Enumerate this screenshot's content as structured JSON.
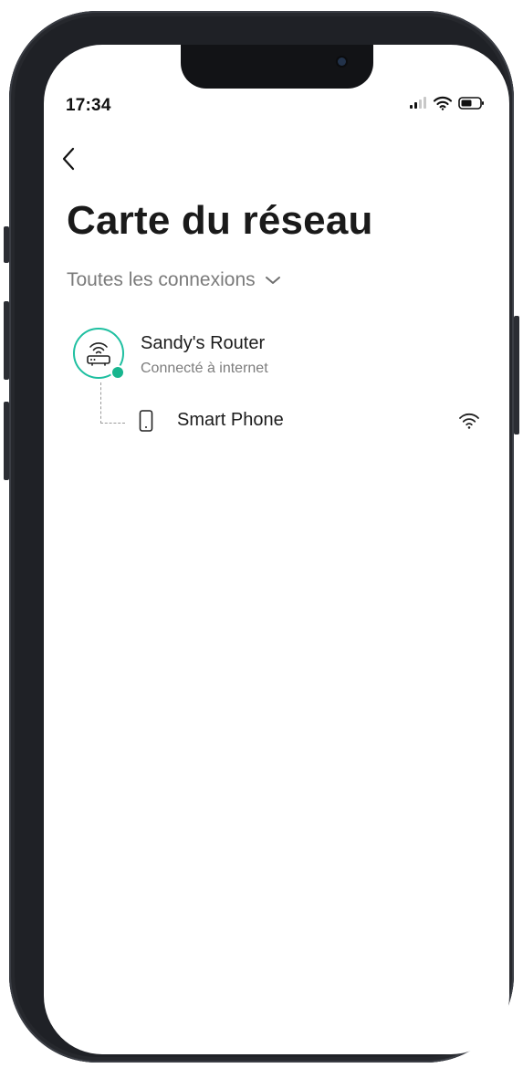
{
  "status_bar": {
    "time": "17:34",
    "signal_icon": "signal-bars-icon",
    "wifi_icon": "wifi-icon",
    "battery_icon": "battery-icon"
  },
  "nav": {
    "back_icon": "chevron-left-icon"
  },
  "page": {
    "title": "Carte du réseau"
  },
  "filter": {
    "label": "Toutes les connexions",
    "icon": "chevron-down-icon"
  },
  "router": {
    "name": "Sandy's Router",
    "status": "Connecté à internet",
    "icon": "router-icon",
    "accent_color": "#1ebfa0"
  },
  "devices": [
    {
      "name": "Smart Phone",
      "icon": "smartphone-icon",
      "connection_icon": "wifi-icon"
    }
  ]
}
